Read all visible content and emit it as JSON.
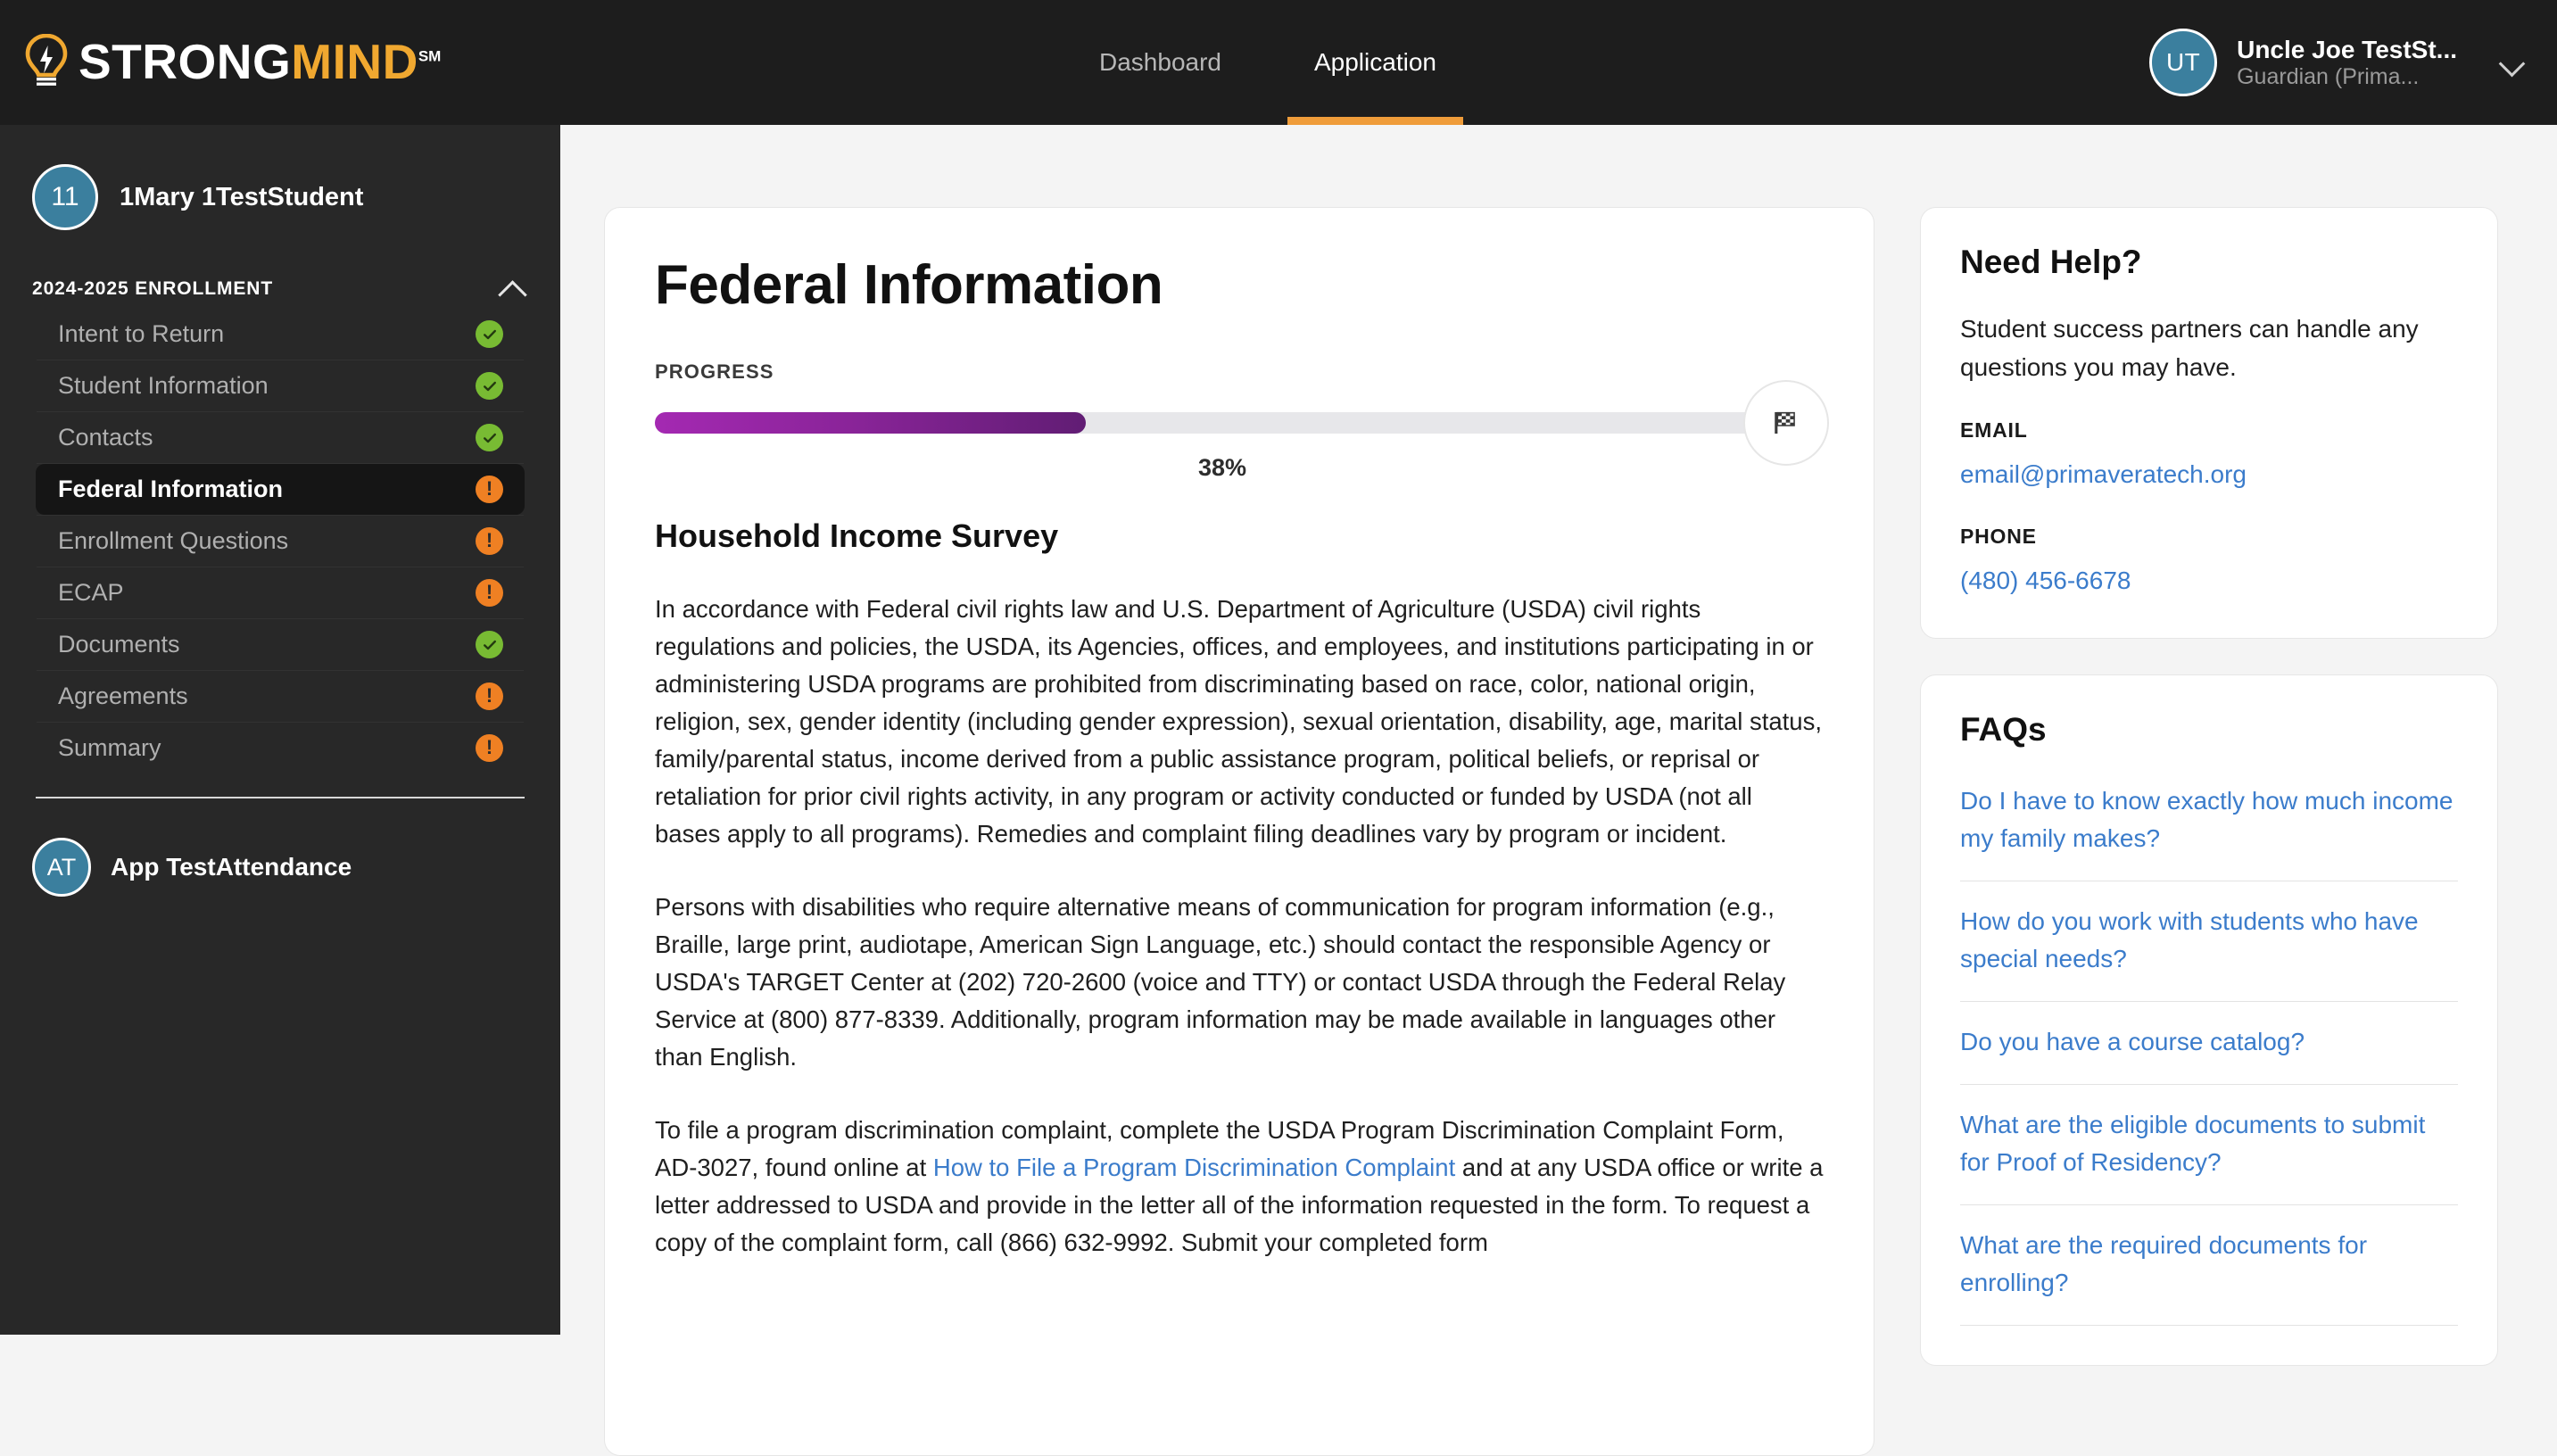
{
  "brand": {
    "name_part1": "STRONG",
    "name_part2": "MIND",
    "trademark": "SM",
    "logo_icon": "lightbulb-lightning-icon",
    "accent_gold": "#f0a830"
  },
  "topnav": {
    "items": [
      {
        "label": "Dashboard",
        "active": false
      },
      {
        "label": "Application",
        "active": true
      }
    ],
    "active_underline_color": "#ef9c3a"
  },
  "user": {
    "initials": "UT",
    "name": "Uncle Joe TestSt...",
    "role": "Guardian (Prima...",
    "avatar_color": "#3b7f9e",
    "chevron_icon": "chevron-down-icon"
  },
  "sidebar": {
    "student": {
      "badge": "11",
      "name": "1Mary 1TestStudent",
      "badge_color": "#3b7f9e"
    },
    "section": {
      "title": "2024-2025 ENROLLMENT",
      "collapse_icon": "chevron-up-icon"
    },
    "items": [
      {
        "label": "Intent to Return",
        "status": "done",
        "active": false
      },
      {
        "label": "Student Information",
        "status": "done",
        "active": false
      },
      {
        "label": "Contacts",
        "status": "done",
        "active": false
      },
      {
        "label": "Federal Information",
        "status": "warn",
        "active": true
      },
      {
        "label": "Enrollment Questions",
        "status": "warn",
        "active": false
      },
      {
        "label": "ECAP",
        "status": "warn",
        "active": false
      },
      {
        "label": "Documents",
        "status": "done",
        "active": false
      },
      {
        "label": "Agreements",
        "status": "warn",
        "active": false
      },
      {
        "label": "Summary",
        "status": "warn",
        "active": false
      }
    ],
    "status_colors": {
      "done": "#78bb33",
      "warn": "#ef8023"
    },
    "footer": {
      "initials": "AT",
      "name": "App TestAttendance"
    }
  },
  "main": {
    "title": "Federal Information",
    "progress": {
      "label": "PROGRESS",
      "percent_text": "38%",
      "percent_value": 38,
      "flag_icon": "checkered-flag-icon",
      "fill_from": "#a429b2",
      "fill_to": "#611d74"
    },
    "section_heading": "Household Income Survey",
    "paragraphs": {
      "p1": "In accordance with Federal civil rights law and U.S. Department of Agriculture (USDA) civil rights regulations and policies, the USDA, its Agencies, offices, and employees, and institutions participating in or administering USDA programs are prohibited from discriminating based on race, color, national origin, religion, sex, gender identity (including gender expression), sexual orientation, disability, age, marital status, family/parental status, income derived from a public assistance program, political beliefs, or reprisal or retaliation for prior civil rights activity, in any program or activity conducted or funded by USDA (not all bases apply to all programs). Remedies and complaint filing deadlines vary by program or incident.",
      "p2": "Persons with disabilities who require alternative means of communication for program information (e.g., Braille, large print, audiotape, American Sign Language, etc.) should contact the responsible Agency or USDA's TARGET Center at (202) 720-2600 (voice and TTY) or contact USDA through the Federal Relay Service at (800) 877-8339. Additionally, program information may be made available in languages other than English.",
      "p3_before": "To file a program discrimination complaint, complete the USDA Program Discrimination Complaint Form, AD-3027, found online at ",
      "p3_link": "How to File a Program Discrimination Complaint",
      "p3_after": " and at any USDA office or write a letter addressed to USDA and provide in the letter all of the information requested in the form. To request a copy of the complaint form, call (866) 632-9992. Submit your completed form"
    }
  },
  "help_card": {
    "title": "Need Help?",
    "body": "Student success partners can handle any questions you may have.",
    "email_label": "EMAIL",
    "email_value": "email@primaveratech.org",
    "phone_label": "PHONE",
    "phone_value": "(480) 456-6678",
    "link_color": "#3b7ccb"
  },
  "faq_card": {
    "title": "FAQs",
    "items": [
      "Do I have to know exactly how much income my family makes?",
      "How do you work with students who have special needs?",
      "Do you have a course catalog?",
      "What are the eligible documents to submit for Proof of Residency?",
      "What are the required documents for enrolling?"
    ]
  }
}
